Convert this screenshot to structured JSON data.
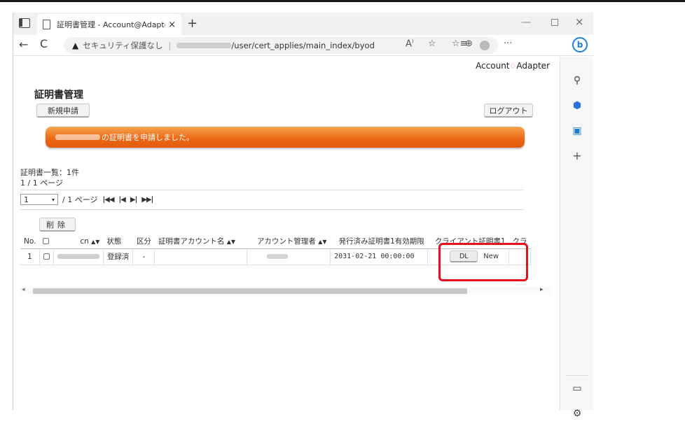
{
  "browser": {
    "tab_title": "証明書管理 - Account@Adapter",
    "tab_close": "×",
    "new_tab": "+",
    "window_min": "—",
    "window_close": "×",
    "nav_back": "←",
    "nav_reload": "C",
    "security_warning": "セキュリティ保護なし",
    "separator": "|",
    "url_path": "/user/cert_applies/main_index/byod",
    "toolbar_more": "···"
  },
  "page": {
    "logo_text_1": "Account",
    "logo_text_2": "Adapter",
    "title": "証明書管理",
    "new_request_button": "新規申請",
    "logout_button": "ログアウト",
    "notice_text": "の証明書を申請しました。",
    "count_text": "証明書一覧：1件",
    "page_info": "1 / 1 ページ",
    "pager": {
      "current_page": "1",
      "total_text": "/ 1 ページ",
      "first": "⏮",
      "prev": "⏴",
      "next": "⏵",
      "last": "⏭"
    },
    "delete_button": "削除"
  },
  "table": {
    "headers": {
      "no": "No.",
      "cn": "cn",
      "status": "状態",
      "category": "区分",
      "cert_account_name": "証明書アカウント名",
      "account_admin": "アカウント管理者",
      "issued_expiry": "発行済み証明書1有効期限",
      "client_cert1": "クライアント証明書1",
      "client_cert2": "クラ"
    },
    "sort_marker": "▲▼",
    "rows": [
      {
        "no": "1",
        "status": "登録済",
        "category": "-",
        "cert_account_name": "",
        "issued_expiry": "2031-02-21 00:00:00",
        "dl_button": "DL",
        "new_label": "New"
      }
    ]
  },
  "sidebar": {
    "bing": "b",
    "search_icon": "⚲",
    "add": "+"
  },
  "colors": {
    "notice_orange": "#ec6a17",
    "highlight_red": "#e8101c",
    "bing_blue": "#1b7fe0"
  }
}
